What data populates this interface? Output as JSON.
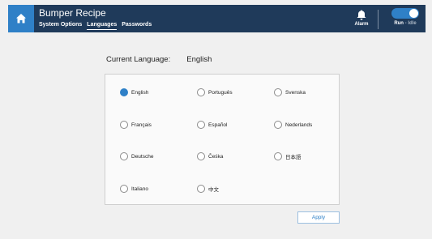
{
  "header": {
    "title": "Bumper Recipe",
    "tabs": [
      {
        "label": "System Options",
        "active": false
      },
      {
        "label": "Languages",
        "active": true
      },
      {
        "label": "Passwords",
        "active": false
      }
    ],
    "alarm_label": "Alarm",
    "mode_run": "Run",
    "mode_sep": " - ",
    "mode_idle": "Idle",
    "accent_color": "#2f80c7",
    "header_color": "#1f3a5a"
  },
  "current_language": {
    "label": "Current Language:",
    "value": "English"
  },
  "languages": [
    {
      "label": "English",
      "selected": true
    },
    {
      "label": "Português",
      "selected": false
    },
    {
      "label": "Svenska",
      "selected": false
    },
    {
      "label": "Français",
      "selected": false
    },
    {
      "label": "Español",
      "selected": false
    },
    {
      "label": "Nederlands",
      "selected": false
    },
    {
      "label": "Deutsche",
      "selected": false
    },
    {
      "label": "Čeśka",
      "selected": false
    },
    {
      "label": "日本語",
      "selected": false
    },
    {
      "label": "Italiano",
      "selected": false
    },
    {
      "label": "中文",
      "selected": false
    }
  ],
  "apply_label": "Apply"
}
